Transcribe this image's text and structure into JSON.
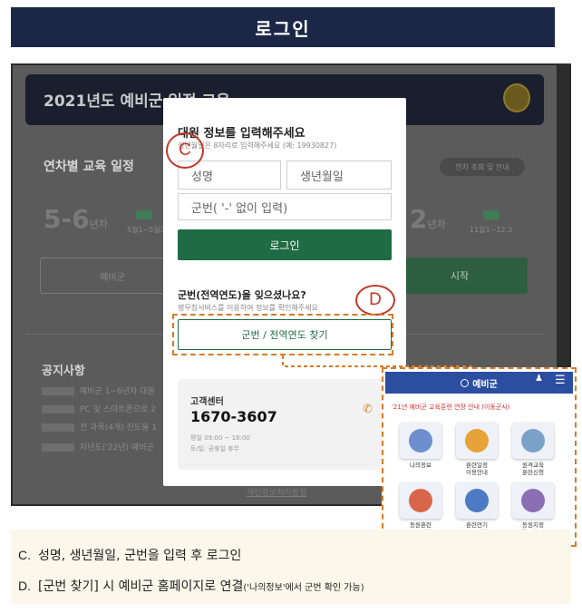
{
  "banner": {
    "title": "로그인"
  },
  "background": {
    "header_title": "2021년도 예비군 일정 교육",
    "schedule_title": "연차별 교육 일정",
    "schedule_pill": "연차 조회 및 안내",
    "big_left": "5-6",
    "big_left_unit": "년차",
    "big_right": "2",
    "big_right_unit": "년차",
    "small_left": "5월1~5월31",
    "small_right": "11월1~12.3",
    "btn_left": "예비군",
    "btn_right": "시작",
    "notice_title": "공지사항",
    "notices": [
      "예비군 1~6년차 대원",
      "PC 및 스마트폰으로 2",
      "전 과목(4개) 진도율 1",
      "차년도('22년) 예비군"
    ],
    "bottom_link": "개인정보처리방침"
  },
  "modal": {
    "title": "대원 정보를 입력해주세요",
    "hint": "생년월일은 8자리로 입력해주세요 (예: 19930827)",
    "name_placeholder": "성명",
    "birth_placeholder": "생년월일",
    "svc_placeholder": "군번( '-' 없이 입력)",
    "login_label": "로그인",
    "forgot_title": "군번(전역연도)을 잊으셨나요?",
    "forgot_hint": "병무청서비스를 이용하여 정보를 확인해주세요",
    "find_label": "군번 / 전역연도 찾기",
    "cc_title": "고객센터",
    "cc_phone": "1670-3607",
    "cc_hours1": "평일 09:00 ~ 18:00",
    "cc_hours2": "토/일, 공휴일 휴무"
  },
  "markers": {
    "c": "C",
    "d": "D"
  },
  "inset": {
    "brand": "예비군",
    "notice": "'21년 예비군 교육훈련 연장 안내 (이동군사)",
    "tiles": [
      {
        "label": "나의정보",
        "icon": "person-icon"
      },
      {
        "label": "훈련일정\n이용안내",
        "icon": "calendar-icon"
      },
      {
        "label": "원격교육\n훈련신청",
        "icon": "presenter-icon"
      },
      {
        "label": "동원훈련\n훈련신청",
        "icon": "schedule-icon"
      },
      {
        "label": "훈련연기\n보류신청",
        "icon": "mail-icon"
      },
      {
        "label": "동원지정\n결과확인",
        "icon": "group-icon"
      }
    ]
  },
  "notes": {
    "c_prefix": "C.",
    "c_text": "성명, 생년월일, 군번을 입력 후 로그인",
    "d_prefix": "D.",
    "d_text": "[군번 찾기] 시 예비군 홈페이지로 연결",
    "d_small": "('나의정보'에서 군번 확인 가능)"
  },
  "colors": {
    "banner": "#1c2748",
    "login_green": "#1f6b43",
    "marker_red": "#c0392b",
    "dash_orange": "#d67b28",
    "inset_blue": "#2b4ea1",
    "notes_bg": "#fbf7ea"
  }
}
